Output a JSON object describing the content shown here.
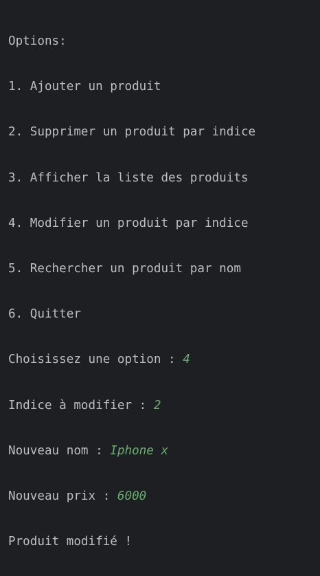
{
  "colors": {
    "background": "#1e1f22",
    "text": "#bcbec4",
    "user_input": "#6aab73"
  },
  "console": {
    "menu": [
      "Options:",
      "1. Ajouter un produit",
      "2. Supprimer un produit par indice",
      "3. Afficher la liste des produits",
      "4. Modifier un produit par indice",
      "5. Rechercher un produit par nom",
      "6. Quitter"
    ],
    "prompts": [
      {
        "label": "Choisissez une option : ",
        "input": "4"
      },
      {
        "label": "Indice à modifier : ",
        "input": "2"
      },
      {
        "label": "Nouveau nom : ",
        "input": "Iphone x"
      },
      {
        "label": "Nouveau prix : ",
        "input": "6000"
      }
    ],
    "result": "Produit modifié !"
  }
}
